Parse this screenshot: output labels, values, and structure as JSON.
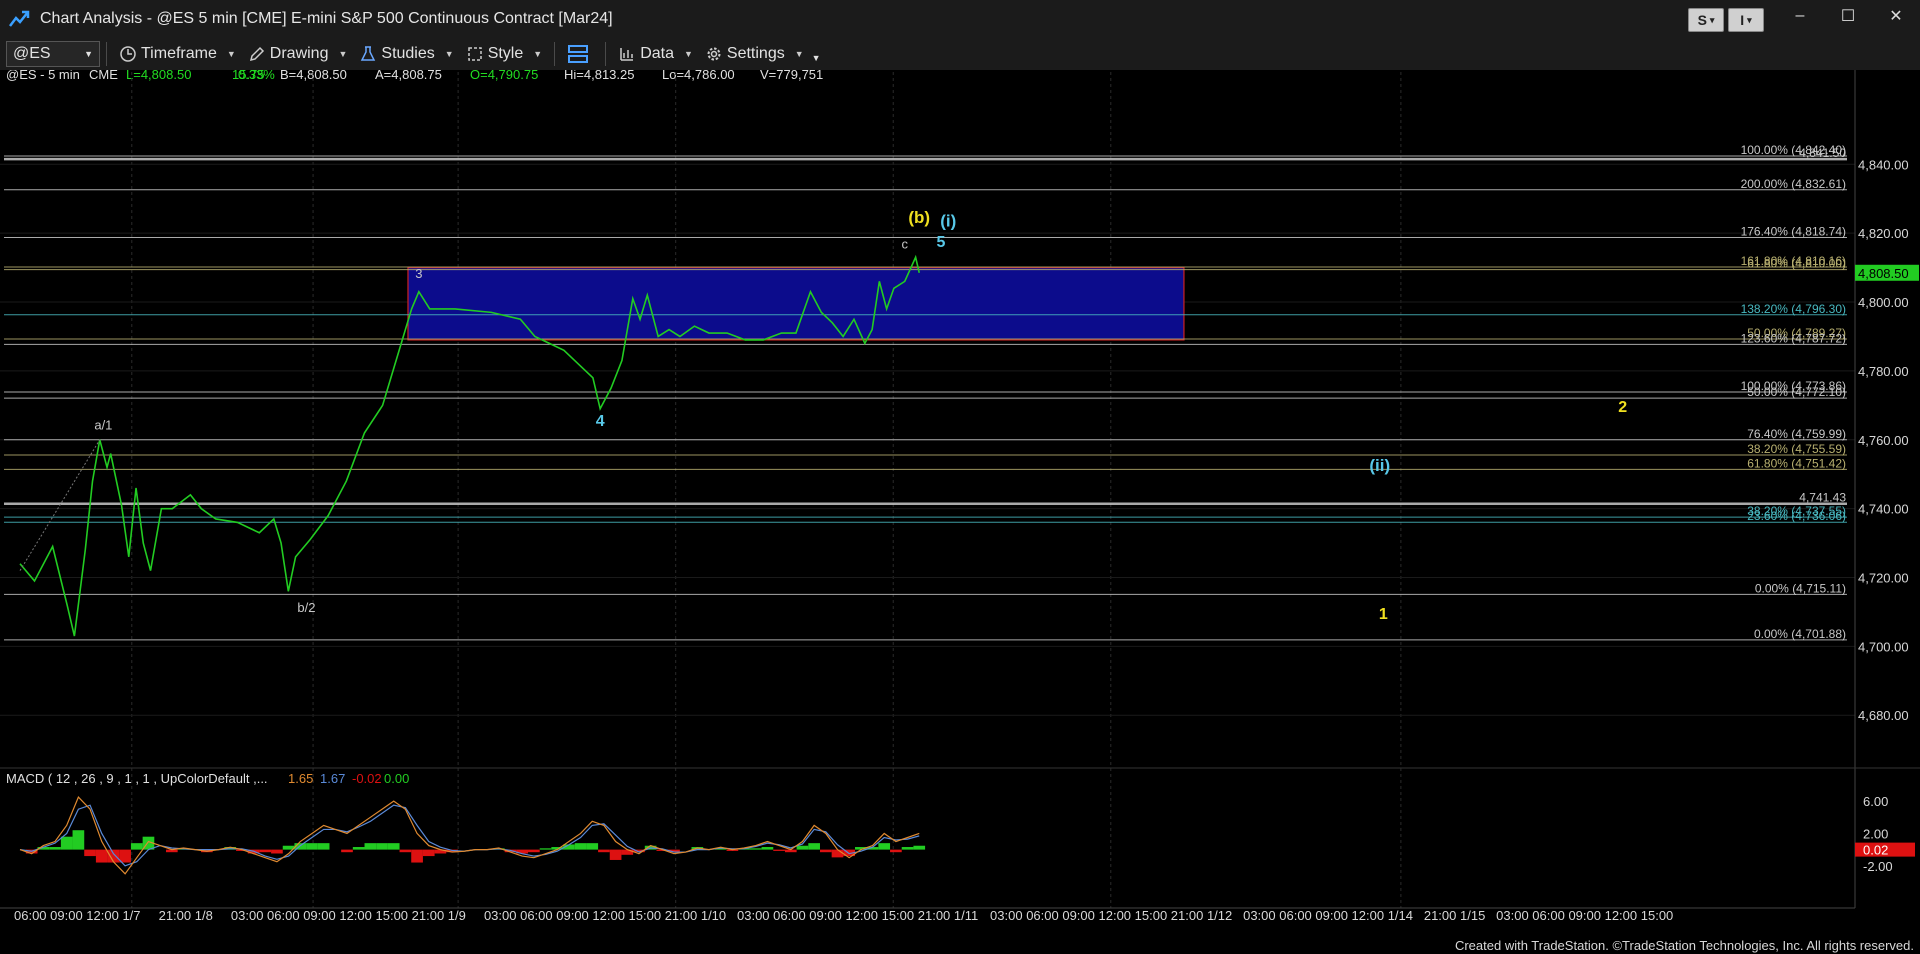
{
  "window": {
    "title": "Chart Analysis - @ES 5 min [CME] E-mini S&P 500 Continuous Contract [Mar24]",
    "btn_s": "S",
    "btn_i": "I",
    "minimize": "–",
    "maximize": "☐",
    "close": "✕"
  },
  "toolbar": {
    "symbol": "@ES",
    "timeframe": "Timeframe",
    "drawing": "Drawing",
    "studies": "Studies",
    "style": "Style",
    "data": "Data",
    "settings": "Settings"
  },
  "quote": {
    "symbol": "@ES - 5 min",
    "exchange": "CME",
    "last": "L=4,808.50",
    "change": "15.75",
    "pct": "0.33%",
    "bid": "B=4,808.50",
    "ask": "A=4,808.75",
    "open": "O=4,790.75",
    "high": "Hi=4,813.25",
    "low": "Lo=4,786.00",
    "volume": "V=779,751"
  },
  "colors": {
    "up": "#22cc22",
    "bg": "#000000",
    "box_fill": "#0c0c8c",
    "box_border": "#cc2222",
    "wave_yellow": "#f0e020",
    "wave_cyan": "#58c8e8",
    "fib_gray": "#c8c8c8",
    "fib_olive": "#b8b070",
    "fib_cyan": "#48b8c0",
    "macd_orange": "#e08a30",
    "macd_blue": "#5a8ad8",
    "macd_neg": "#dd1111",
    "macd_pos": "#22cc22"
  },
  "chart_data": {
    "type": "line",
    "price_axis": {
      "ticks": [
        4840,
        4820,
        4800,
        4780,
        4760,
        4740,
        4720,
        4700,
        4680
      ],
      "tick_labels": [
        "4,840.00",
        "4,820.00",
        "4,800.00",
        "4,780.00",
        "4,760.00",
        "4,740.00",
        "4,720.00",
        "4,700.00",
        "4,680.00"
      ],
      "ylim": [
        4667,
        4861
      ],
      "last_price": 4808.5,
      "last_label": "4,808.50"
    },
    "time_axis": {
      "labels": [
        "06:00",
        "09:00",
        "12:00",
        "1/7",
        "21:00",
        "1/8",
        "03:00",
        "06:00",
        "09:00",
        "12:00",
        "15:00",
        "21:00",
        "1/9",
        "03:00",
        "06:00",
        "09:00",
        "12:00",
        "15:00",
        "21:00",
        "1/10",
        "03:00",
        "06:00",
        "09:00",
        "12:00",
        "15:00",
        "21:00",
        "1/11",
        "03:00",
        "06:00",
        "09:00",
        "12:00",
        "15:00",
        "21:00",
        "1/12",
        "03:00",
        "06:00",
        "09:00",
        "12:00",
        "1/14",
        "21:00",
        "1/15",
        "03:00",
        "06:00",
        "09:00",
        "12:00",
        "15:00"
      ],
      "n": 46
    },
    "price_series": [
      {
        "i": 0.0,
        "v": 4724
      },
      {
        "i": 0.4,
        "v": 4719
      },
      {
        "i": 0.9,
        "v": 4729
      },
      {
        "i": 1.3,
        "v": 4712
      },
      {
        "i": 1.5,
        "v": 4703
      },
      {
        "i": 1.8,
        "v": 4728
      },
      {
        "i": 2.0,
        "v": 4748
      },
      {
        "i": 2.2,
        "v": 4760
      },
      {
        "i": 2.4,
        "v": 4752
      },
      {
        "i": 2.5,
        "v": 4756
      },
      {
        "i": 2.8,
        "v": 4741
      },
      {
        "i": 3.0,
        "v": 4726
      },
      {
        "i": 3.2,
        "v": 4746
      },
      {
        "i": 3.4,
        "v": 4730
      },
      {
        "i": 3.6,
        "v": 4722
      },
      {
        "i": 3.9,
        "v": 4740
      },
      {
        "i": 4.2,
        "v": 4740
      },
      {
        "i": 4.7,
        "v": 4744
      },
      {
        "i": 5.0,
        "v": 4740
      },
      {
        "i": 5.4,
        "v": 4737
      },
      {
        "i": 6.0,
        "v": 4736
      },
      {
        "i": 6.6,
        "v": 4733
      },
      {
        "i": 7.0,
        "v": 4737
      },
      {
        "i": 7.2,
        "v": 4730
      },
      {
        "i": 7.4,
        "v": 4716
      },
      {
        "i": 7.6,
        "v": 4726
      },
      {
        "i": 8.0,
        "v": 4731
      },
      {
        "i": 8.5,
        "v": 4738
      },
      {
        "i": 9.0,
        "v": 4748
      },
      {
        "i": 9.5,
        "v": 4762
      },
      {
        "i": 10.0,
        "v": 4770
      },
      {
        "i": 10.4,
        "v": 4784
      },
      {
        "i": 10.8,
        "v": 4798
      },
      {
        "i": 11.0,
        "v": 4803
      },
      {
        "i": 11.3,
        "v": 4798
      },
      {
        "i": 12.0,
        "v": 4798
      },
      {
        "i": 13.0,
        "v": 4797
      },
      {
        "i": 13.8,
        "v": 4795
      },
      {
        "i": 14.2,
        "v": 4790
      },
      {
        "i": 14.6,
        "v": 4788
      },
      {
        "i": 15.0,
        "v": 4786
      },
      {
        "i": 15.4,
        "v": 4782
      },
      {
        "i": 15.8,
        "v": 4778
      },
      {
        "i": 16.0,
        "v": 4769
      },
      {
        "i": 16.3,
        "v": 4775
      },
      {
        "i": 16.6,
        "v": 4783
      },
      {
        "i": 16.9,
        "v": 4801
      },
      {
        "i": 17.1,
        "v": 4795
      },
      {
        "i": 17.3,
        "v": 4802
      },
      {
        "i": 17.6,
        "v": 4790
      },
      {
        "i": 17.9,
        "v": 4792
      },
      {
        "i": 18.2,
        "v": 4790
      },
      {
        "i": 18.6,
        "v": 4793
      },
      {
        "i": 19.0,
        "v": 4791
      },
      {
        "i": 19.5,
        "v": 4791
      },
      {
        "i": 20.0,
        "v": 4789
      },
      {
        "i": 20.5,
        "v": 4789
      },
      {
        "i": 21.0,
        "v": 4791
      },
      {
        "i": 21.4,
        "v": 4791
      },
      {
        "i": 21.8,
        "v": 4803
      },
      {
        "i": 22.1,
        "v": 4797
      },
      {
        "i": 22.4,
        "v": 4794
      },
      {
        "i": 22.7,
        "v": 4790
      },
      {
        "i": 23.0,
        "v": 4795
      },
      {
        "i": 23.3,
        "v": 4788
      },
      {
        "i": 23.5,
        "v": 4792
      },
      {
        "i": 23.7,
        "v": 4806
      },
      {
        "i": 23.9,
        "v": 4798
      },
      {
        "i": 24.1,
        "v": 4804
      },
      {
        "i": 24.4,
        "v": 4806
      },
      {
        "i": 24.7,
        "v": 4813
      },
      {
        "i": 24.8,
        "v": 4808.5
      }
    ],
    "fib_levels": [
      {
        "label": "100.00% (4,842.40)",
        "value": 4842.4,
        "color": "gray"
      },
      {
        "label": "4,841.50",
        "value": 4841.5,
        "color": "gray"
      },
      {
        "label": "200.00% (4,832.61)",
        "value": 4832.61,
        "color": "gray"
      },
      {
        "label": "176.40% (4,818.74)",
        "value": 4818.74,
        "color": "gray"
      },
      {
        "label": "161.80% (4,810.16)",
        "value": 4810.16,
        "color": "olive"
      },
      {
        "label": "61.80% (4,810.00)",
        "value": 4809.4,
        "color": "olive"
      },
      {
        "label": "138.20% (4,796.30)",
        "value": 4796.3,
        "color": "cyan"
      },
      {
        "label": "50.00% (4,789.27)",
        "value": 4789.27,
        "color": "olive"
      },
      {
        "label": "123.60% (4,787.72)",
        "value": 4787.72,
        "color": "gray"
      },
      {
        "label": "100.00% (4,773.86)",
        "value": 4773.86,
        "color": "gray"
      },
      {
        "label": "50.00% (4,772.10)",
        "value": 4772.1,
        "color": "gray"
      },
      {
        "label": "76.40% (4,759.99)",
        "value": 4759.99,
        "color": "gray"
      },
      {
        "label": "38.20% (4,755.59)",
        "value": 4755.59,
        "color": "olive"
      },
      {
        "label": "61.80% (4,751.42)",
        "value": 4751.42,
        "color": "olive"
      },
      {
        "label": "4,741.43",
        "value": 4741.43,
        "color": "gray"
      },
      {
        "label": "38.20% (4,737.55)",
        "value": 4737.55,
        "color": "cyan"
      },
      {
        "label": "23.60% (4,736.06)",
        "value": 4736.06,
        "color": "cyan"
      },
      {
        "label": "0.00% (4,715.11)",
        "value": 4715.11,
        "color": "gray"
      },
      {
        "label": "0.00% (4,701.88)",
        "value": 4701.88,
        "color": "gray"
      }
    ],
    "box": {
      "i_start": 10.7,
      "i_end": 32.1,
      "top": 4810,
      "bottom": 4789
    },
    "wave_labels": [
      {
        "text": "a/1",
        "i": 2.3,
        "v": 4763,
        "color": "gray"
      },
      {
        "text": "b/2",
        "i": 7.9,
        "v": 4710,
        "color": "gray"
      },
      {
        "text": "3",
        "i": 11.0,
        "v": 4807,
        "color": "gray"
      },
      {
        "text": "4",
        "i": 16.0,
        "v": 4764,
        "color": "cyan"
      },
      {
        "text": "c",
        "i": 24.4,
        "v": 4815.5,
        "color": "gray"
      },
      {
        "text": "5",
        "i": 25.4,
        "v": 4816,
        "color": "cyan"
      },
      {
        "text": "(b)",
        "i": 24.8,
        "v": 4823,
        "color": "yellow"
      },
      {
        "text": "(i)",
        "i": 25.6,
        "v": 4822,
        "color": "cyan"
      },
      {
        "text": "2",
        "i": 44.2,
        "v": 4768,
        "color": "yellow"
      },
      {
        "text": "(ii)",
        "i": 37.5,
        "v": 4751,
        "color": "cyan"
      },
      {
        "text": "1",
        "i": 37.6,
        "v": 4708,
        "color": "yellow"
      }
    ],
    "macd": {
      "label": "MACD ( 12 , 26 , 9 , 1 , 1 , UpColorDefault ,...",
      "values": [
        "1.65",
        "1.67",
        "-0.02",
        "0.00"
      ],
      "ticks": [
        6,
        2,
        -2
      ],
      "tick_labels": [
        "6.00",
        "2.00",
        "-2.00"
      ],
      "last_label": "0.02",
      "ylim": [
        -5,
        8
      ],
      "macd_line": [
        0,
        -0.5,
        0.5,
        1,
        3,
        6.5,
        5,
        1,
        -1.5,
        -3,
        -1,
        1,
        0.5,
        0,
        0.2,
        0,
        -0.2,
        0,
        0.3,
        0,
        -0.5,
        -1,
        -1.5,
        -0.5,
        1,
        2,
        3,
        2.5,
        2,
        3,
        4,
        5,
        6,
        5,
        2,
        0.5,
        0,
        -0.3,
        -0.2,
        0,
        0,
        0.2,
        -0.3,
        -0.8,
        -1,
        -0.5,
        0,
        1,
        2,
        3.5,
        3,
        1,
        0,
        -0.5,
        0.5,
        0,
        -0.5,
        -0.3,
        0.2,
        0,
        0.3,
        0,
        0.2,
        0.5,
        1,
        0.5,
        0,
        1,
        3,
        2,
        0,
        -1,
        0,
        0.5,
        2,
        1,
        1.5,
        2
      ],
      "signal_line": [
        0,
        -0.2,
        0.3,
        0.8,
        2,
        5,
        5.5,
        2,
        -0.5,
        -2,
        -1.5,
        0,
        0.5,
        0.2,
        0.1,
        0,
        0,
        0,
        0.1,
        0.1,
        -0.2,
        -0.8,
        -1.2,
        -0.8,
        0.5,
        1.5,
        2.5,
        2.5,
        2.2,
        2.8,
        3.5,
        4.5,
        5.5,
        5.2,
        3,
        1,
        0.3,
        -0.1,
        -0.2,
        0,
        0,
        0.1,
        -0.1,
        -0.5,
        -0.8,
        -0.6,
        -0.2,
        0.6,
        1.5,
        3,
        3.2,
        1.8,
        0.4,
        -0.3,
        0.2,
        0.1,
        -0.3,
        -0.3,
        0,
        0,
        0.2,
        0.1,
        0.1,
        0.4,
        0.8,
        0.6,
        0.2,
        0.7,
        2.5,
        2.2,
        0.6,
        -0.5,
        -0.2,
        0.3,
        1.5,
        1.2,
        1.3,
        1.7
      ],
      "hist": [
        0,
        -0.3,
        0.2,
        0.2,
        1,
        1.5,
        -0.5,
        -1,
        -1,
        -1,
        0.5,
        1,
        0,
        -0.2,
        0.1,
        0,
        -0.2,
        0,
        0.2,
        -0.1,
        -0.3,
        -0.2,
        -0.3,
        0.3,
        0.5,
        0.5,
        0.5,
        0,
        -0.2,
        0.2,
        0.5,
        0.5,
        0.5,
        -0.2,
        -1,
        -0.5,
        -0.3,
        -0.2,
        0,
        0,
        0,
        0.1,
        -0.2,
        -0.3,
        -0.2,
        0.1,
        0.2,
        0.4,
        0.5,
        0.5,
        -0.2,
        -0.8,
        -0.4,
        -0.2,
        0.3,
        -0.1,
        -0.2,
        0,
        0.2,
        0,
        0.1,
        -0.1,
        0.1,
        0.1,
        0.2,
        -0.1,
        -0.2,
        0.3,
        0.5,
        -0.2,
        -0.6,
        -0.5,
        0.2,
        0.2,
        0.5,
        -0.2,
        0.2,
        0.3
      ]
    }
  },
  "footer": "Created with TradeStation. ©TradeStation Technologies, Inc. All rights reserved."
}
